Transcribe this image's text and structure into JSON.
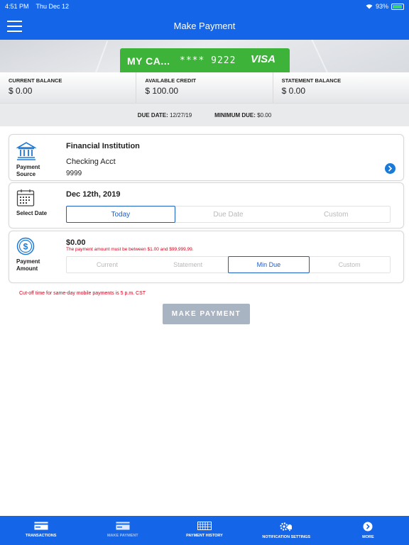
{
  "status_bar": {
    "time": "4:51 PM",
    "date": "Thu Dec 12",
    "battery": "93%"
  },
  "nav": {
    "title": "Make Payment"
  },
  "card": {
    "name": "MY CA...",
    "digits": "**** 9222",
    "brand": "VISA"
  },
  "balances": [
    {
      "label": "CURRENT BALANCE",
      "value": "$ 0.00"
    },
    {
      "label": "AVAILABLE CREDIT",
      "value": "$ 100.00"
    },
    {
      "label": "STATEMENT BALANCE",
      "value": "$ 0.00"
    }
  ],
  "due": {
    "due_label": "DUE DATE:",
    "due_value": "12/27/19",
    "min_label": "MINIMUM DUE:",
    "min_value": "$0.00"
  },
  "payment_source": {
    "side_label_1": "Payment",
    "side_label_2": "Source",
    "title": "Financial Institution",
    "account": "Checking Acct",
    "number": "9999"
  },
  "select_date": {
    "side_label": "Select Date",
    "value": "Dec 12th, 2019",
    "options": [
      "Today",
      "Due Date",
      "Custom"
    ],
    "selected": "Today"
  },
  "payment_amount": {
    "side_label_1": "Payment",
    "side_label_2": "Amount",
    "value": "$0.00",
    "error": "The payment amount must be between $1.00 and $99,999.99.",
    "options": [
      "Current",
      "Statement",
      "Min Due",
      "Custom"
    ],
    "selected": "Min Due"
  },
  "cutoff_note": "Cut-off time for same-day mobile payments is 5 p.m. CST",
  "make_payment_button": "MAKE PAYMENT",
  "tabs": [
    {
      "label": "TRANSACTIONS",
      "icon": "card-icon"
    },
    {
      "label": "MAKE PAYMENT",
      "icon": "card-outline-icon"
    },
    {
      "label": "PAYMENT HISTORY",
      "icon": "calendar-grid-icon"
    },
    {
      "label": "NOTIFICATION SETTINGS",
      "icon": "gear-bell-icon"
    },
    {
      "label": "MORE",
      "icon": "chevron-circle-icon"
    }
  ],
  "colors": {
    "primary": "#1565e8",
    "card_green": "#3db33a",
    "error": "#d0021b",
    "accent_blue": "#1a5fc4",
    "button_disabled": "#a9b4c2"
  }
}
